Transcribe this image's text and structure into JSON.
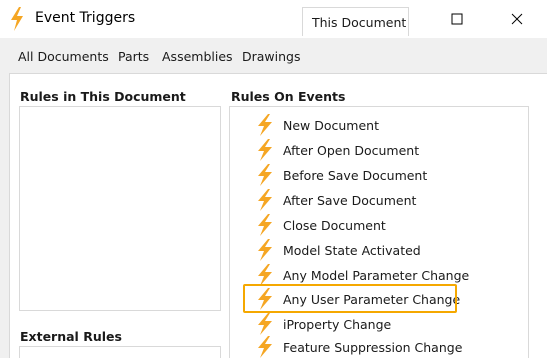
{
  "window": {
    "title": "Event Triggers",
    "icon": "lightning-bolt-icon"
  },
  "tabs": [
    {
      "label": "All Documents"
    },
    {
      "label": "Parts"
    },
    {
      "label": "Assemblies"
    },
    {
      "label": "Drawings"
    },
    {
      "label": "This Document",
      "active": true
    }
  ],
  "sections": {
    "rules_in_document": "Rules in This Document",
    "rules_on_events": "Rules On Events",
    "external_rules": "External Rules"
  },
  "events": [
    {
      "label": "New Document"
    },
    {
      "label": "After Open Document"
    },
    {
      "label": "Before Save Document"
    },
    {
      "label": "After Save Document"
    },
    {
      "label": "Close Document"
    },
    {
      "label": "Model State Activated"
    },
    {
      "label": "Any Model Parameter Change"
    },
    {
      "label": "Any User Parameter Change",
      "highlighted": true
    },
    {
      "label": "iProperty Change"
    },
    {
      "label": "Feature Suppression Change"
    }
  ],
  "colors": {
    "bolt_orange": "#f5a623",
    "highlight_border": "#f5a800"
  }
}
